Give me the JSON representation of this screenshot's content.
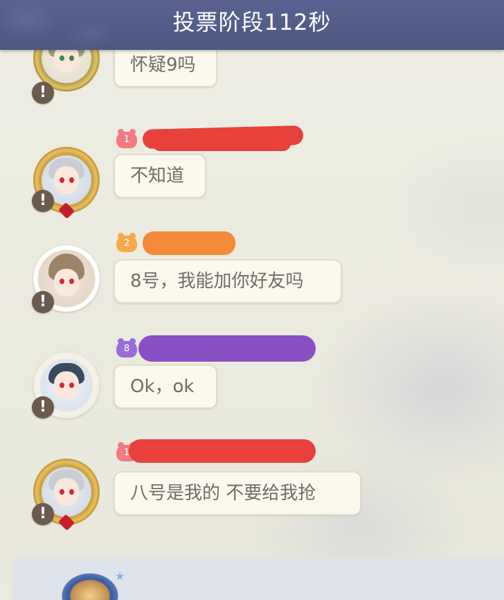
{
  "header": {
    "title": "投票阶段112秒"
  },
  "messages": [
    {
      "seat": "",
      "name_redaction_color": "",
      "text": "怀疑9吗",
      "avatar": "cat-ear-avatar"
    },
    {
      "seat": "1",
      "seat_badge_color": "#ee7c80",
      "name_redaction_color": "#e8403a",
      "text": "不知道",
      "avatar": "gold-frame-avatar"
    },
    {
      "seat": "2",
      "seat_badge_color": "#f5a94f",
      "name_redaction_color": "#f58a3a",
      "text": "8号，我能加你好友吗",
      "avatar": "brown-hair-avatar"
    },
    {
      "seat": "8",
      "seat_badge_color": "#9a6dd6",
      "name_redaction_color": "#8a4fc2",
      "text": "Ok，ok",
      "avatar": "blue-ornament-avatar"
    },
    {
      "seat": "1",
      "seat_badge_color": "#ee7c80",
      "name_redaction_color": "#e8403a",
      "text": "八号是我的 不要给我抢",
      "avatar": "gold-frame-avatar"
    }
  ],
  "report_icon": "warning-icon",
  "colors": {
    "header_bg": "#55608c",
    "bubble_bg": "#fbf8ee",
    "bubble_text": "#6f6d66"
  }
}
